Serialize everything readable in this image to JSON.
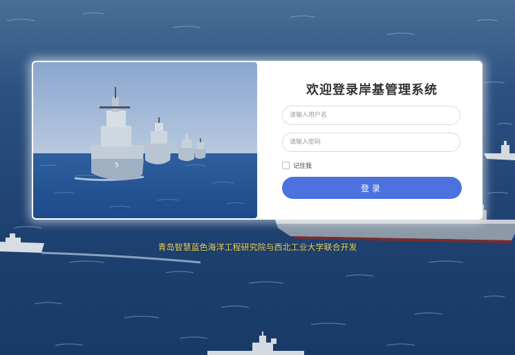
{
  "login": {
    "title": "欢迎登录岸基管理系统",
    "username_placeholder": "请输入用户名",
    "password_placeholder": "请输入密码",
    "remember_label": "记住我",
    "login_button": "登录"
  },
  "footer": {
    "text": "青岛智慧蓝色海洋工程研究院与西北工业大学联合开发"
  },
  "colors": {
    "accent": "#4b72de",
    "footer_text": "#e8d45a",
    "sea_dark": "#1b3a66"
  }
}
